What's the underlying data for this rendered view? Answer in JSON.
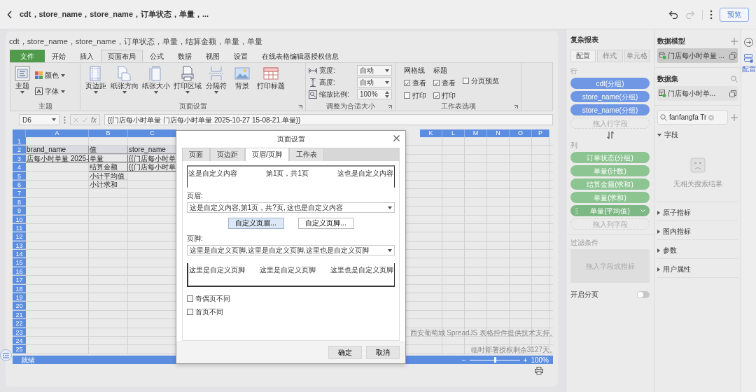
{
  "top_bar": {
    "title": "cdt，store_name，store_name，订单状态，单量，...",
    "undo_disabled": false,
    "redo_disabled": true,
    "preview_button": "预览"
  },
  "sheet": {
    "title": "cdt，store_name，store_name，订单状态，单量，结算金额，单量，单量",
    "ribbon_tabs": [
      {
        "label": "文件",
        "kind": "file",
        "selected": false
      },
      {
        "label": "开始",
        "kind": "tab",
        "selected": false
      },
      {
        "label": "插入",
        "kind": "tab",
        "selected": false
      },
      {
        "label": "页面布局",
        "kind": "tab",
        "selected": true
      },
      {
        "label": "公式",
        "kind": "tab",
        "selected": false
      },
      {
        "label": "数据",
        "kind": "tab",
        "selected": false
      },
      {
        "label": "视图",
        "kind": "tab",
        "selected": false
      },
      {
        "label": "设置",
        "kind": "tab",
        "selected": false
      },
      {
        "label": "在线表格编辑器授权信息",
        "kind": "tab",
        "selected": false
      }
    ],
    "theme_group": {
      "label": "主题",
      "theme_button": "主题",
      "color_button": "颜色",
      "font_button": "字体"
    },
    "page_setup_group": {
      "label": "页面设置",
      "buttons": [
        {
          "label": "页边距",
          "kind": "margins",
          "menu": true
        },
        {
          "label": "纸张方向",
          "kind": "orientation",
          "menu": true
        },
        {
          "label": "纸张大小",
          "kind": "size",
          "menu": true
        },
        {
          "label": "打印区域",
          "kind": "print_area",
          "menu": true
        },
        {
          "label": "分隔符",
          "kind": "breaks",
          "menu": true
        },
        {
          "label": "背景",
          "kind": "background",
          "menu": false
        },
        {
          "label": "打印标题",
          "kind": "print_titles",
          "menu": false
        }
      ]
    },
    "scale_group": {
      "label": "调整为合适大小",
      "fields": [
        {
          "label": "宽度:",
          "value": "自动",
          "kind": "width"
        },
        {
          "label": "高度:",
          "value": "自动",
          "kind": "height"
        },
        {
          "label": "缩放比例:",
          "value": "100%",
          "kind": "scale"
        }
      ]
    },
    "sheet_options_group": {
      "label": "工作表选项",
      "columns": [
        {
          "heading": "网格线",
          "options": [
            {
              "label": "查看",
              "checked": true
            },
            {
              "label": "打印",
              "checked": false
            }
          ]
        },
        {
          "heading": "标题",
          "options": [
            {
              "label": "查看",
              "checked": true
            },
            {
              "label": "打印",
              "checked": true
            }
          ]
        }
      ],
      "page_break_preview": {
        "label": "分页预览",
        "checked": false
      }
    },
    "formula_bar": {
      "cell": "D6",
      "fx": "fx",
      "formula": "{{门店每小时单量 门店每小时单量 2025-10-27 15-08-21.单量}}"
    },
    "columns_left": [
      "A",
      "B",
      "C"
    ],
    "columns_right": [
      "K",
      "L",
      "M",
      "N",
      "O",
      "P"
    ],
    "rows": [
      {
        "number": "1"
      },
      {
        "number": "2",
        "kind": "header",
        "cells": {
          "A": "brand_name",
          "B": "值",
          "C": "store_name"
        }
      },
      {
        "number": "3",
        "kind": "boxed",
        "cells": {
          "A": "店每小时单量 2025-",
          "B": "单量",
          "C": "{{门店每小时单"
        }
      },
      {
        "number": "4",
        "kind": "boxed",
        "cells": {
          "B": "结算金额",
          "C": "{{门店每小时单"
        }
      },
      {
        "number": "5",
        "kind": "plain",
        "cells": {
          "B": "小计平均值"
        }
      },
      {
        "number": "6",
        "kind": "plain",
        "cells": {
          "B": "小计求和"
        }
      },
      {
        "number": "7"
      },
      {
        "number": "8"
      },
      {
        "number": "9"
      },
      {
        "number": "10"
      },
      {
        "number": "11"
      },
      {
        "number": "12"
      },
      {
        "number": "13"
      },
      {
        "number": "14"
      },
      {
        "number": "15"
      },
      {
        "number": "16"
      },
      {
        "number": "17"
      },
      {
        "number": "18"
      },
      {
        "number": "19"
      },
      {
        "number": "20"
      },
      {
        "number": "21"
      },
      {
        "number": "22"
      },
      {
        "number": "23"
      },
      {
        "number": "24"
      },
      {
        "number": "25"
      }
    ],
    "notice": [
      "西安葡萄城 SpreadJS 表格控件提供技术支持。",
      "临时部署授权剩余3127天。"
    ],
    "status_bar": {
      "text": "就绪",
      "zoom_out": "−",
      "zoom_in": "+",
      "zoom": "100%",
      "level": 0.5
    }
  },
  "dialog": {
    "title": "页面设置",
    "tabs": [
      {
        "label": "页面",
        "selected": false
      },
      {
        "label": "页边距",
        "selected": false
      },
      {
        "label": "页眉/页脚",
        "selected": true
      },
      {
        "label": "工作表",
        "selected": false
      }
    ],
    "header_preview": [
      "这是自定义内容",
      "第1页，共1页",
      "这也是自定义内容"
    ],
    "header_label": "页眉:",
    "header_value": "这是自定义内容,第1页，共?页, 这也是自定义内容",
    "custom_buttons": [
      {
        "label": "自定义页眉...",
        "focused": true
      },
      {
        "label": "自定义页脚...",
        "focused": false
      }
    ],
    "footer_label": "页脚:",
    "footer_value": "这里是自定义页脚,这里是自定义页脚,这里也是自定义页脚",
    "footer_preview": [
      "这里是自定义页脚",
      "这里是自定义页脚",
      "这里也是自定义页脚"
    ],
    "options": [
      {
        "label": "奇偶页不同",
        "checked": false
      },
      {
        "label": "首页不同",
        "checked": false
      }
    ],
    "ok": "确定",
    "cancel": "取消"
  },
  "report_panel": {
    "title": "复杂报表",
    "tabs": [
      {
        "label": "配置",
        "selected": true
      },
      {
        "label": "样式",
        "selected": false
      },
      {
        "label": "单元格",
        "selected": false
      }
    ],
    "rows_label": "行",
    "row_fields": [
      "cdt(分组)",
      "store_name(分组)",
      "store_name(分组)"
    ],
    "row_drop": "拖入行字段",
    "columns_label": "列",
    "column_fields": [
      {
        "label": "订单状态(分组)",
        "hovered": false
      },
      {
        "label": "单量(计数)",
        "hovered": false
      },
      {
        "label": "结算金额(求和)",
        "hovered": false
      },
      {
        "label": "单量(求和)",
        "hovered": false
      },
      {
        "label": "单量(平均值)",
        "hovered": true
      }
    ],
    "column_drop": "拖入列字段",
    "filter_label": "过滤条件",
    "filter_drop": "拖入字段或指标",
    "pagination": {
      "label": "开启分页",
      "on": false
    }
  },
  "data_panel": {
    "model_title": "数据模型",
    "models": [
      {
        "label": "门店每小时单量 ...",
        "selected": true
      }
    ],
    "dataset_title": "数据集",
    "datasets": [
      {
        "label": "门店每小时单...",
        "selected": false
      }
    ],
    "search": {
      "value": "fanfangfa Tr"
    },
    "sections": [
      {
        "label": "字段",
        "expanded": true,
        "empty_text": "无相关搜索结果"
      },
      {
        "label": "原子指标",
        "expanded": false
      },
      {
        "label": "图内指标",
        "expanded": false
      },
      {
        "label": "参数",
        "expanded": false
      },
      {
        "label": "用户属性",
        "expanded": false
      }
    ]
  },
  "side_strip": {
    "label": "配置",
    "selected": true
  }
}
